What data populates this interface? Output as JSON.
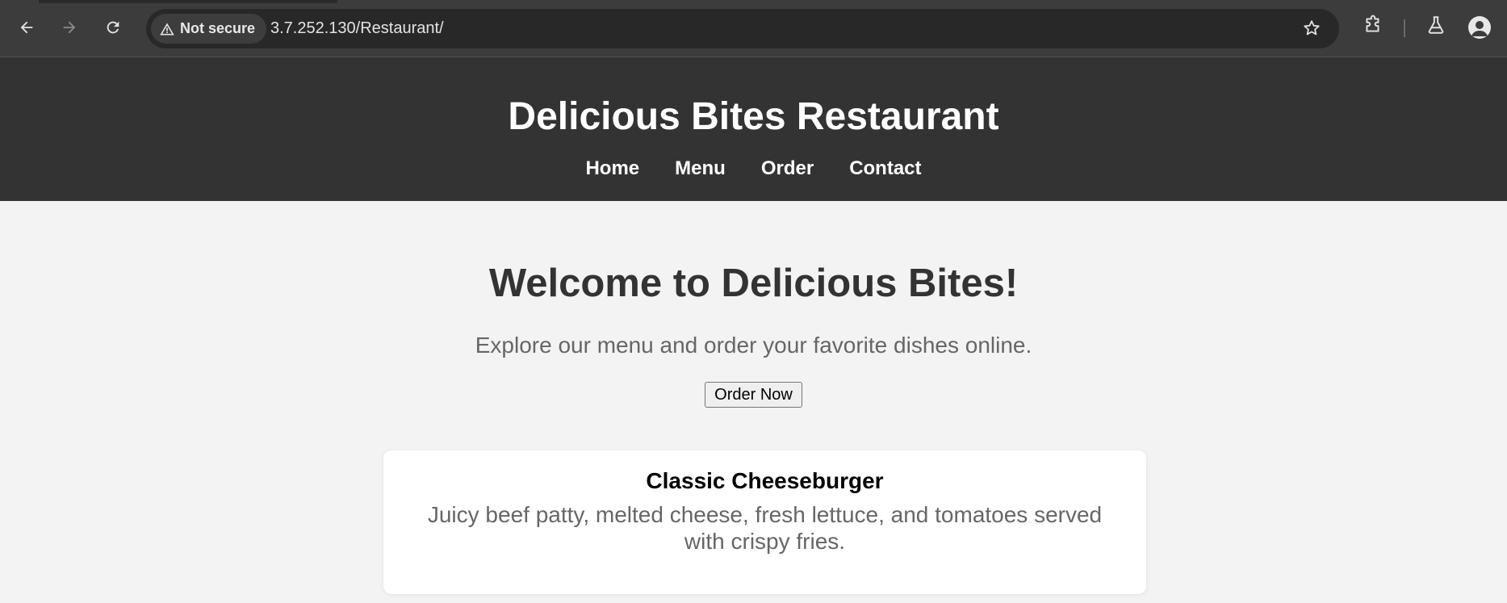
{
  "browser": {
    "security_label": "Not secure",
    "url": "3.7.252.130/Restaurant/",
    "icons": {
      "back": "back-arrow-icon",
      "forward": "forward-arrow-icon",
      "reload": "reload-icon",
      "warning": "warning-icon",
      "bookmark": "star-icon",
      "extensions": "puzzle-icon",
      "labs": "flask-icon",
      "profile": "profile-icon"
    }
  },
  "header": {
    "title": "Delicious Bites Restaurant",
    "nav": [
      "Home",
      "Menu",
      "Order",
      "Contact"
    ]
  },
  "hero": {
    "heading": "Welcome to Delicious Bites!",
    "subtitle": "Explore our menu and order your favorite dishes online.",
    "button_label": "Order Now"
  },
  "menu_items": [
    {
      "name": "Classic Cheeseburger",
      "description": "Juicy beef patty, melted cheese, fresh lettuce, and tomatoes served with crispy fries."
    }
  ],
  "colors": {
    "header_bg": "#333333",
    "page_bg": "#f3f3f3",
    "heading_text": "#333333",
    "muted_text": "#666666"
  }
}
